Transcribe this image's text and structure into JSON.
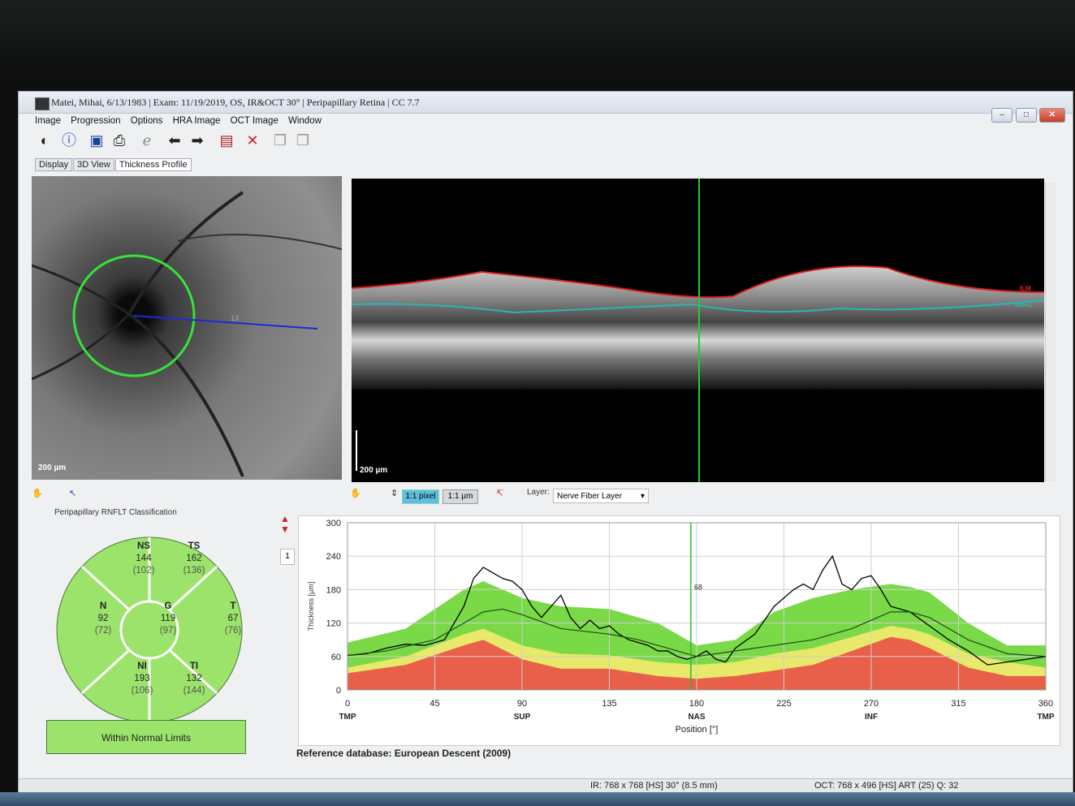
{
  "window": {
    "title": "Matei, Mihai, 6/13/1983  |  Exam: 11/19/2019, OS, IR&OCT 30°  |  Peripapillary Retina  |  CC 7.7",
    "controls": {
      "minimize": "–",
      "maximize": "□",
      "close": "✕"
    }
  },
  "menu": [
    "Image",
    "Progression",
    "Options",
    "HRA Image",
    "OCT Image",
    "Window"
  ],
  "tabs": [
    {
      "label": "Display"
    },
    {
      "label": "3D View"
    },
    {
      "label": "Thickness Profile"
    }
  ],
  "ir_image": {
    "scale_label": "200 µm",
    "scan_label": "13"
  },
  "oct_image": {
    "scale_label": "200 µm",
    "ilm_label": "ILM",
    "rnfl_label": "RNFL"
  },
  "lower_toolbar": {
    "pixel_btn": "1:1 pixel",
    "um_btn": "1:1 µm",
    "layer_label": "Layer:",
    "layer_value": "Nerve Fiber Layer",
    "page_num": "1"
  },
  "classification": {
    "title": "Peripapillary RNFLT Classification",
    "sectors": {
      "NS": {
        "label": "NS",
        "value": "144",
        "ref": "(102)"
      },
      "TS": {
        "label": "TS",
        "value": "162",
        "ref": "(136)"
      },
      "N": {
        "label": "N",
        "value": "92",
        "ref": "(72)"
      },
      "G": {
        "label": "G",
        "value": "119",
        "ref": "(97)"
      },
      "T": {
        "label": "T",
        "value": "67",
        "ref": "(76)"
      },
      "NI": {
        "label": "NI",
        "value": "193",
        "ref": "(106)"
      },
      "TI": {
        "label": "TI",
        "value": "132",
        "ref": "(144)"
      }
    },
    "result": "Within Normal Limits",
    "colors": {
      "normal": "#9be36b",
      "border": "#ffffff"
    }
  },
  "chart_data": {
    "type": "line",
    "ylabel": "Thickness [µm]",
    "xlabel": "Position [°]",
    "ylim": [
      0,
      300
    ],
    "xlim": [
      0,
      360
    ],
    "yticks": [
      0,
      60,
      120,
      180,
      240,
      300
    ],
    "xticks": [
      0,
      45,
      90,
      135,
      180,
      225,
      270,
      315,
      360
    ],
    "xtick_sublabels": [
      "TMP",
      "",
      "SUP",
      "",
      "NAS",
      "",
      "INF",
      "",
      "TMP"
    ],
    "cursor": {
      "x": 177,
      "label": "68"
    },
    "series": [
      {
        "color": "#000000",
        "x": [
          0,
          10,
          20,
          30,
          40,
          50,
          60,
          65,
          70,
          75,
          80,
          85,
          90,
          95,
          100,
          105,
          110,
          115,
          120,
          125,
          130,
          135,
          140,
          145,
          150,
          155,
          160,
          165,
          170,
          175,
          180,
          185,
          190,
          195,
          200,
          210,
          220,
          230,
          235,
          240,
          245,
          250,
          255,
          260,
          265,
          270,
          275,
          280,
          290,
          300,
          310,
          320,
          330,
          340,
          350,
          360
        ],
        "y": [
          62,
          65,
          75,
          82,
          80,
          90,
          150,
          200,
          220,
          210,
          200,
          195,
          180,
          150,
          130,
          150,
          170,
          130,
          110,
          125,
          110,
          115,
          100,
          90,
          85,
          80,
          70,
          70,
          60,
          55,
          60,
          70,
          55,
          50,
          75,
          100,
          150,
          180,
          190,
          180,
          215,
          240,
          190,
          180,
          200,
          205,
          180,
          150,
          140,
          115,
          90,
          70,
          45,
          50,
          55,
          60
        ]
      },
      {
        "color": "#1f4a1f",
        "x": [
          0,
          20,
          45,
          60,
          70,
          80,
          90,
          110,
          135,
          150,
          170,
          180,
          190,
          210,
          240,
          260,
          280,
          290,
          300,
          320,
          340,
          360
        ],
        "y": [
          62,
          70,
          90,
          120,
          140,
          145,
          135,
          110,
          100,
          90,
          70,
          60,
          65,
          75,
          90,
          110,
          140,
          140,
          130,
          90,
          65,
          60
        ]
      }
    ],
    "bands": [
      {
        "name": "green",
        "color": "#7ad947",
        "x": [
          0,
          30,
          60,
          70,
          90,
          110,
          135,
          160,
          180,
          200,
          220,
          240,
          260,
          280,
          290,
          300,
          320,
          340,
          360
        ],
        "upper": [
          85,
          110,
          180,
          195,
          165,
          150,
          145,
          120,
          80,
          90,
          140,
          165,
          180,
          190,
          185,
          175,
          120,
          80,
          80
        ]
      },
      {
        "name": "yellow",
        "color": "#e8e86a",
        "x": [
          0,
          30,
          60,
          70,
          90,
          110,
          135,
          160,
          180,
          200,
          220,
          240,
          260,
          280,
          290,
          300,
          320,
          340,
          360
        ],
        "upper": [
          40,
          60,
          100,
          110,
          80,
          65,
          62,
          50,
          45,
          50,
          65,
          75,
          95,
          115,
          110,
          100,
          65,
          50,
          40
        ]
      },
      {
        "name": "red",
        "color": "#e9604a",
        "x": [
          0,
          30,
          60,
          70,
          90,
          110,
          135,
          160,
          180,
          200,
          220,
          240,
          260,
          280,
          290,
          300,
          320,
          340,
          360
        ],
        "upper": [
          30,
          45,
          80,
          90,
          55,
          38,
          38,
          25,
          20,
          25,
          35,
          45,
          70,
          95,
          90,
          75,
          40,
          25,
          25
        ]
      }
    ]
  },
  "reference_db": "Reference database: European Descent (2009)",
  "status": {
    "ir": "IR: 768 x 768 [HS] 30° (8.5 mm)",
    "oct": "OCT: 768 x 496 [HS] ART (25) Q: 32"
  }
}
